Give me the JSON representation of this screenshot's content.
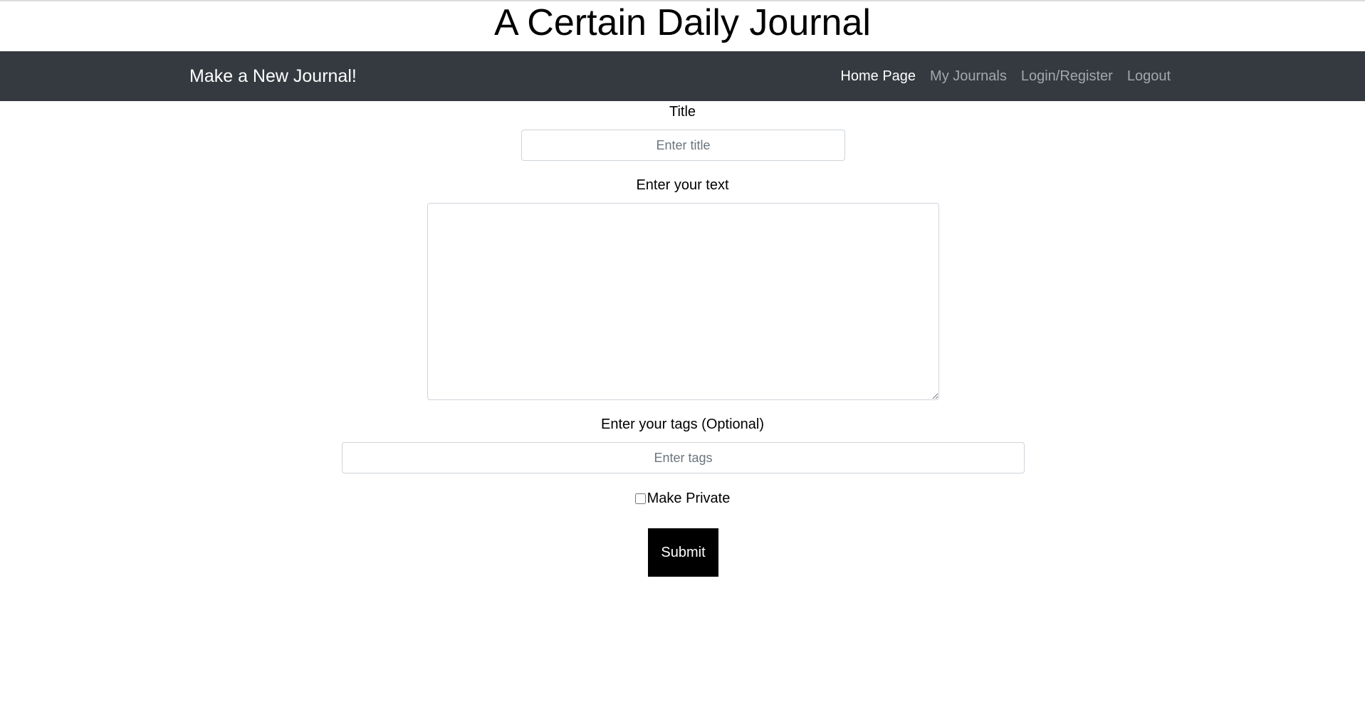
{
  "header": {
    "title": "A Certain Daily Journal"
  },
  "navbar": {
    "brand": "Make a New Journal!",
    "links": [
      {
        "label": "Home Page",
        "active": true
      },
      {
        "label": "My Journals",
        "active": false
      },
      {
        "label": "Login/Register",
        "active": false
      },
      {
        "label": "Logout",
        "active": false
      }
    ]
  },
  "form": {
    "title_label": "Title",
    "title_placeholder": "Enter title",
    "title_value": "",
    "text_label": "Enter your text",
    "text_value": "",
    "tags_label": "Enter your tags (Optional)",
    "tags_placeholder": "Enter tags",
    "tags_value": "",
    "private_label": "Make Private",
    "private_checked": false,
    "submit_label": "Submit"
  },
  "colors": {
    "navbar_bg": "#343a40",
    "submit_bg": "#000000",
    "nav_active": "#ffffff",
    "nav_inactive": "rgba(255,255,255,0.55)"
  }
}
